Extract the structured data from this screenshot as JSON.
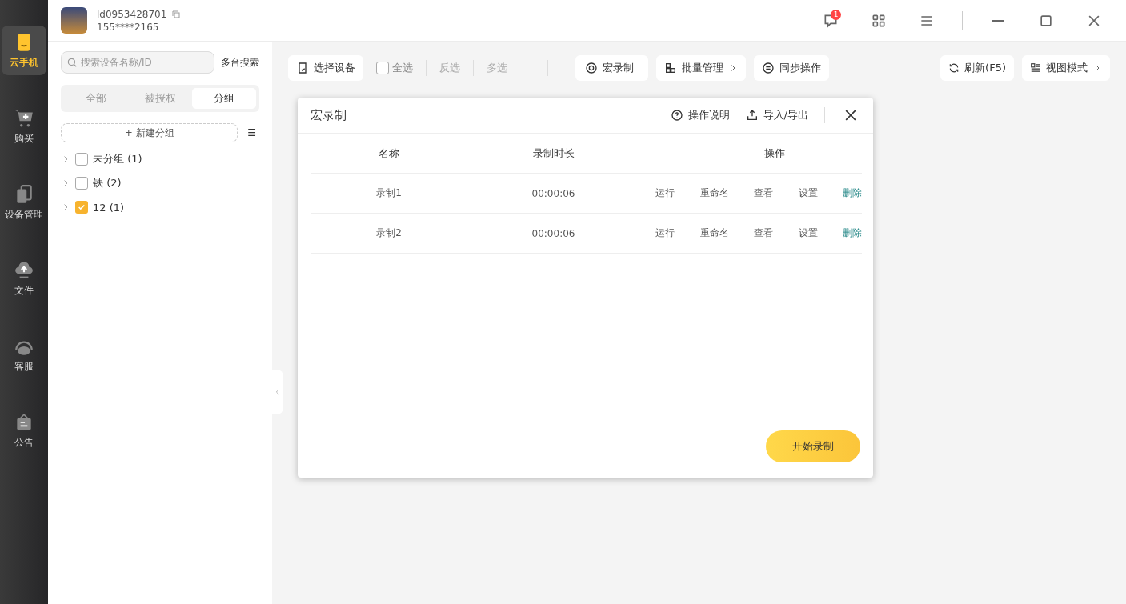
{
  "nav": [
    {
      "label": "云手机",
      "selected": true
    },
    {
      "label": "购买",
      "selected": false
    },
    {
      "label": "设备管理",
      "selected": false
    },
    {
      "label": "文件",
      "selected": false
    },
    {
      "label": "客服",
      "selected": false
    },
    {
      "label": "公告",
      "selected": false
    }
  ],
  "account": {
    "id": "ld0953428701",
    "phone": "155****2165"
  },
  "notifications": {
    "count": "1"
  },
  "sidebar": {
    "search_placeholder": "搜索设备名称/ID",
    "multi_search": "多台搜索",
    "tabs": [
      {
        "label": "全部",
        "selected": false
      },
      {
        "label": "被授权",
        "selected": false
      },
      {
        "label": "分组",
        "selected": true
      }
    ],
    "new_group": "+ 新建分组",
    "sort_icon": "☰",
    "groups": [
      {
        "label": "未分组 (1)",
        "checked": false
      },
      {
        "label": "铁 (2)",
        "checked": false
      },
      {
        "label": "12 (1)",
        "checked": true
      }
    ]
  },
  "toolbar": {
    "select_device": "选择设备",
    "select_all": {
      "label": "全选",
      "checked": false
    },
    "invert": "反选",
    "multi": "多选",
    "macro": "宏录制",
    "batch": "批量管理",
    "sync": "同步操作",
    "refresh": "刷新(F5)",
    "view_mode": "视图模式"
  },
  "dialog": {
    "title": "宏录制",
    "help": "操作说明",
    "import_export": "导入/导出",
    "columns": [
      "名称",
      "录制时长",
      "操作"
    ],
    "rows": [
      {
        "name": "录制1",
        "duration": "00:00:06",
        "actions": [
          "运行",
          "重命名",
          "查看",
          "设置",
          "删除"
        ]
      },
      {
        "name": "录制2",
        "duration": "00:00:06",
        "actions": [
          "运行",
          "重命名",
          "查看",
          "设置",
          "删除"
        ]
      }
    ],
    "start_button": "开始录制"
  }
}
